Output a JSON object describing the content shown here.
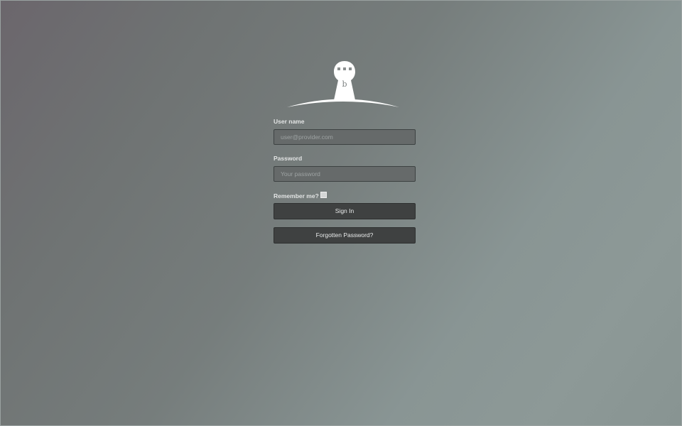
{
  "logo": {
    "icon": "lighthouse-tower-icon",
    "letter": "b"
  },
  "form": {
    "username": {
      "label": "User name",
      "placeholder": "user@provider.com",
      "value": ""
    },
    "password": {
      "label": "Password",
      "placeholder": "Your password",
      "value": ""
    },
    "remember": {
      "label": "Remember me?",
      "checked": false
    },
    "sign_in_label": "Sign In",
    "forgot_label": "Forgotten Password?"
  },
  "colors": {
    "button_bg": "#3f4141",
    "input_bg": "#666a6a",
    "label_text": "#e2e4e4"
  }
}
